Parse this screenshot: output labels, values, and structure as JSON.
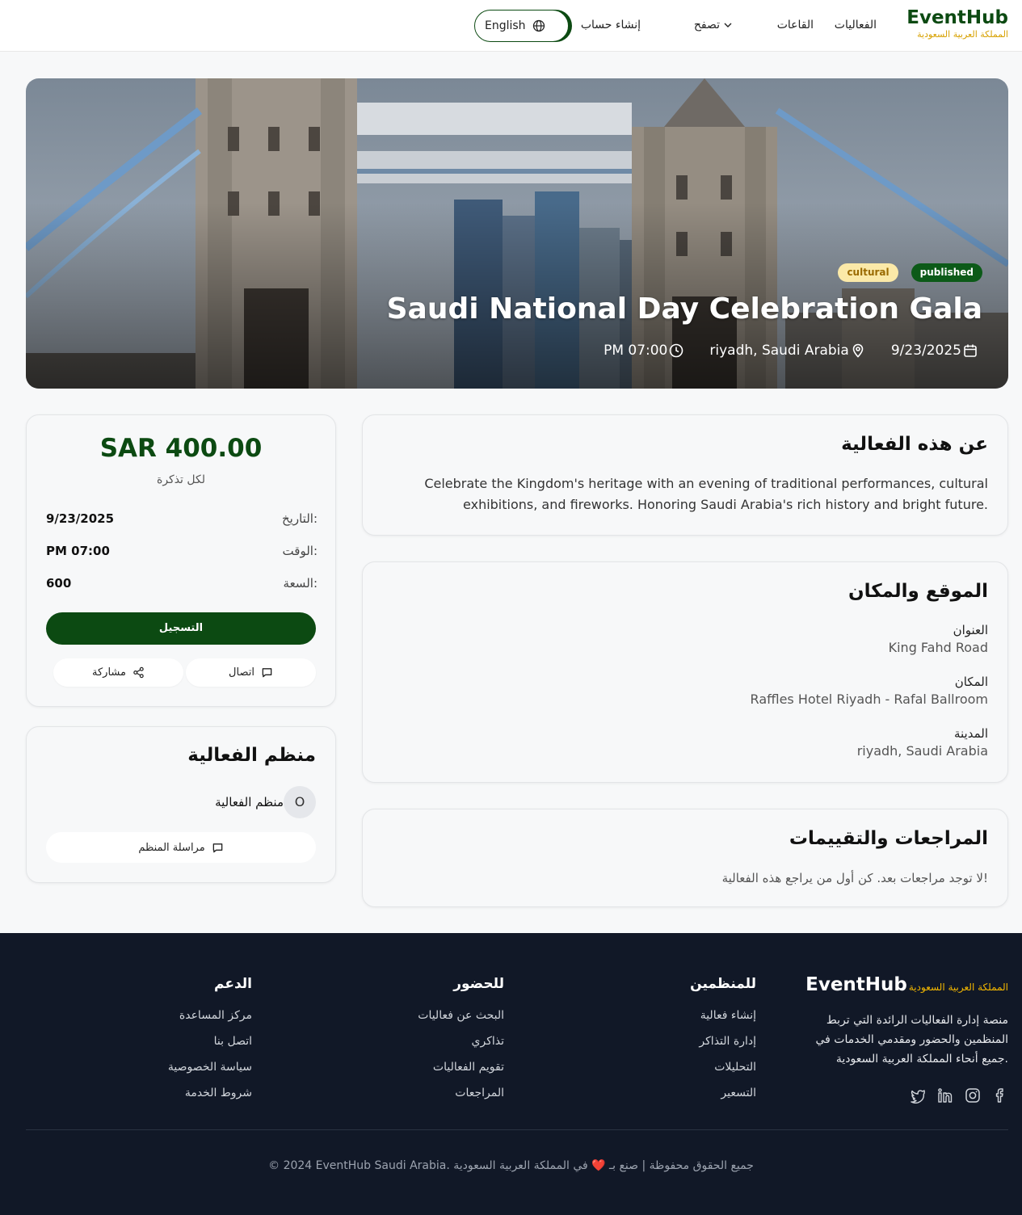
{
  "nav": {
    "brand": "EventHub",
    "brand_sub": "المملكة العربية السعودية",
    "events": "الفعاليات",
    "halls": "القاعات",
    "browse": "تصفح",
    "signup": "إنشاء حساب",
    "language": "English"
  },
  "event": {
    "status": "published",
    "category": "cultural",
    "title": "Saudi National Day Celebration Gala",
    "date": "9/23/2025",
    "location": "riyadh, Saudi Arabia",
    "time": "PM 07:00"
  },
  "about": {
    "heading": "عن هذه الفعالية",
    "text": "Celebrate the Kingdom's heritage with an evening of traditional performances, cultural exhibitions, and fireworks. Honoring Saudi Arabia's rich history and bright future."
  },
  "location": {
    "heading": "الموقع والمكان",
    "address_label": "العنوان",
    "address": "King Fahd Road",
    "venue_label": "المكان",
    "venue": "Raffles Hotel Riyadh - Rafal Ballroom",
    "city_label": "المدينة",
    "city": "riyadh, Saudi Arabia"
  },
  "reviews": {
    "heading": "المراجعات والتقييمات",
    "empty": "لا توجد مراجعات بعد. كن أول من يراجع هذه الفعالية!"
  },
  "ticket": {
    "price": "SAR 400.00",
    "per_ticket": "لكل تذكرة",
    "date_label": "التاريخ:",
    "date": "9/23/2025",
    "time_label": "الوقت:",
    "time": "PM 07:00",
    "capacity_label": "السعة:",
    "capacity": "600",
    "register": "التسجيل",
    "contact": "اتصال",
    "share": "مشاركة"
  },
  "organizer": {
    "heading": "منظم الفعالية",
    "initial": "O",
    "name": "منظم الفعالية",
    "message": "مراسلة المنظم"
  },
  "footer": {
    "brand": "EventHub",
    "brand_sub": "المملكة العربية السعودية",
    "description": "منصة إدارة الفعاليات الرائدة التي تربط المنظمين والحضور ومقدمي الخدمات في جميع أنحاء المملكة العربية السعودية.",
    "social": [
      "twitter-icon",
      "linkedin-icon",
      "instagram-icon",
      "facebook-icon"
    ],
    "organizers": {
      "heading": "للمنظمين",
      "links": [
        "إنشاء فعالية",
        "إدارة التذاكر",
        "التحليلات",
        "التسعير"
      ]
    },
    "attendees": {
      "heading": "للحضور",
      "links": [
        "البحث عن فعاليات",
        "تذاكري",
        "تقويم الفعاليات",
        "المراجعات"
      ]
    },
    "support": {
      "heading": "الدعم",
      "links": [
        "مركز المساعدة",
        "اتصل بنا",
        "سياسة الخصوصية",
        "شروط الخدمة"
      ]
    },
    "copyright": "© 2024 EventHub Saudi Arabia. جميع الحقوق محفوظة",
    "made_in": "صنع بـ ❤️ في المملكة العربية السعودية"
  },
  "colors": {
    "brand_green": "#0c4a12",
    "accent_gold": "#d7a100",
    "footer_bg": "#111827",
    "badge_cultural_bg": "#fbe9a8"
  }
}
